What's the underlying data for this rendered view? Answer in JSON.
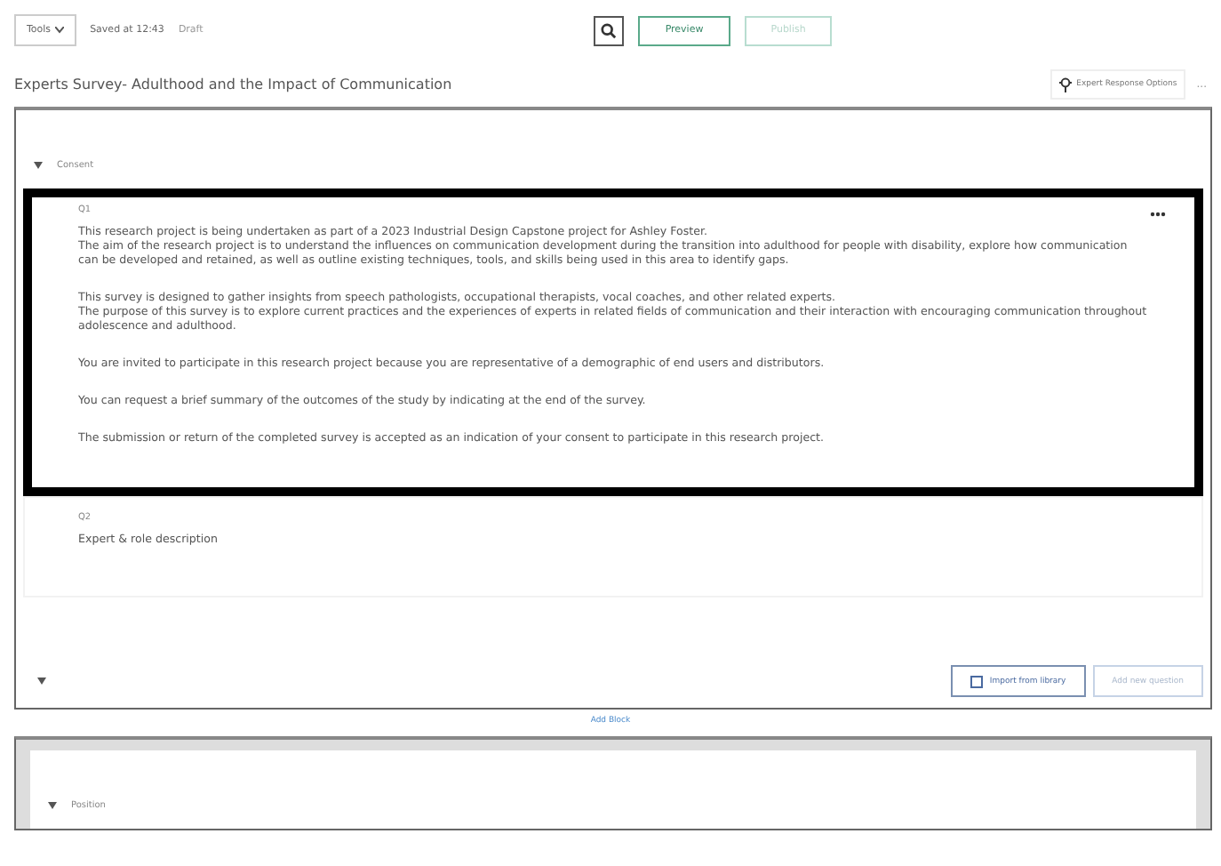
{
  "toolbar": {
    "tools_label": "Tools",
    "saved": "Saved at 12:43",
    "status": "Draft",
    "buttons": [
      {
        "label": "Preview",
        "disabled": false
      },
      {
        "label": "Publish",
        "disabled": true
      }
    ]
  },
  "survey_title": "Experts Survey- Adulthood and the Impact of Communication",
  "options_button": "Expert Response Options",
  "more_label": "...",
  "blocks": [
    {
      "name": "Consent",
      "expanded": true,
      "questions": [
        {
          "number": "Q1",
          "selected": true,
          "paragraphs": [
            [
              "This research project is being undertaken as part of a 2023 Industrial Design Capstone project for Ashley Foster.",
              "The aim of the research project is to understand the influences on communication development during the transition into adulthood for people with disability, explore how communication can be developed and retained, as well as outline existing techniques, tools, and skills being used in this area to identify gaps."
            ],
            [
              "This survey is designed to gather insights from speech pathologists, occupational therapists, vocal coaches, and other related experts.",
              "The purpose of this survey is to explore current practices and the experiences of experts in related fields of communication and their interaction with encouraging communication throughout adolescence and adulthood."
            ],
            [
              "You are invited to participate in this research project because you are representative of a demographic of end users and distributors."
            ],
            [
              "You can request a brief summary of the outcomes of the study by indicating at the end of the survey."
            ],
            [
              "The submission or return of the completed survey is accepted as an indication of your consent to participate in this research project."
            ]
          ]
        },
        {
          "number": "Q2",
          "selected": false,
          "paragraphs": [
            [
              "Expert & role description"
            ]
          ]
        }
      ],
      "footer_buttons": [
        "Import from library",
        "Add new question"
      ]
    },
    {
      "name": "Position",
      "expanded": true
    }
  ],
  "add_block": "Add Block"
}
